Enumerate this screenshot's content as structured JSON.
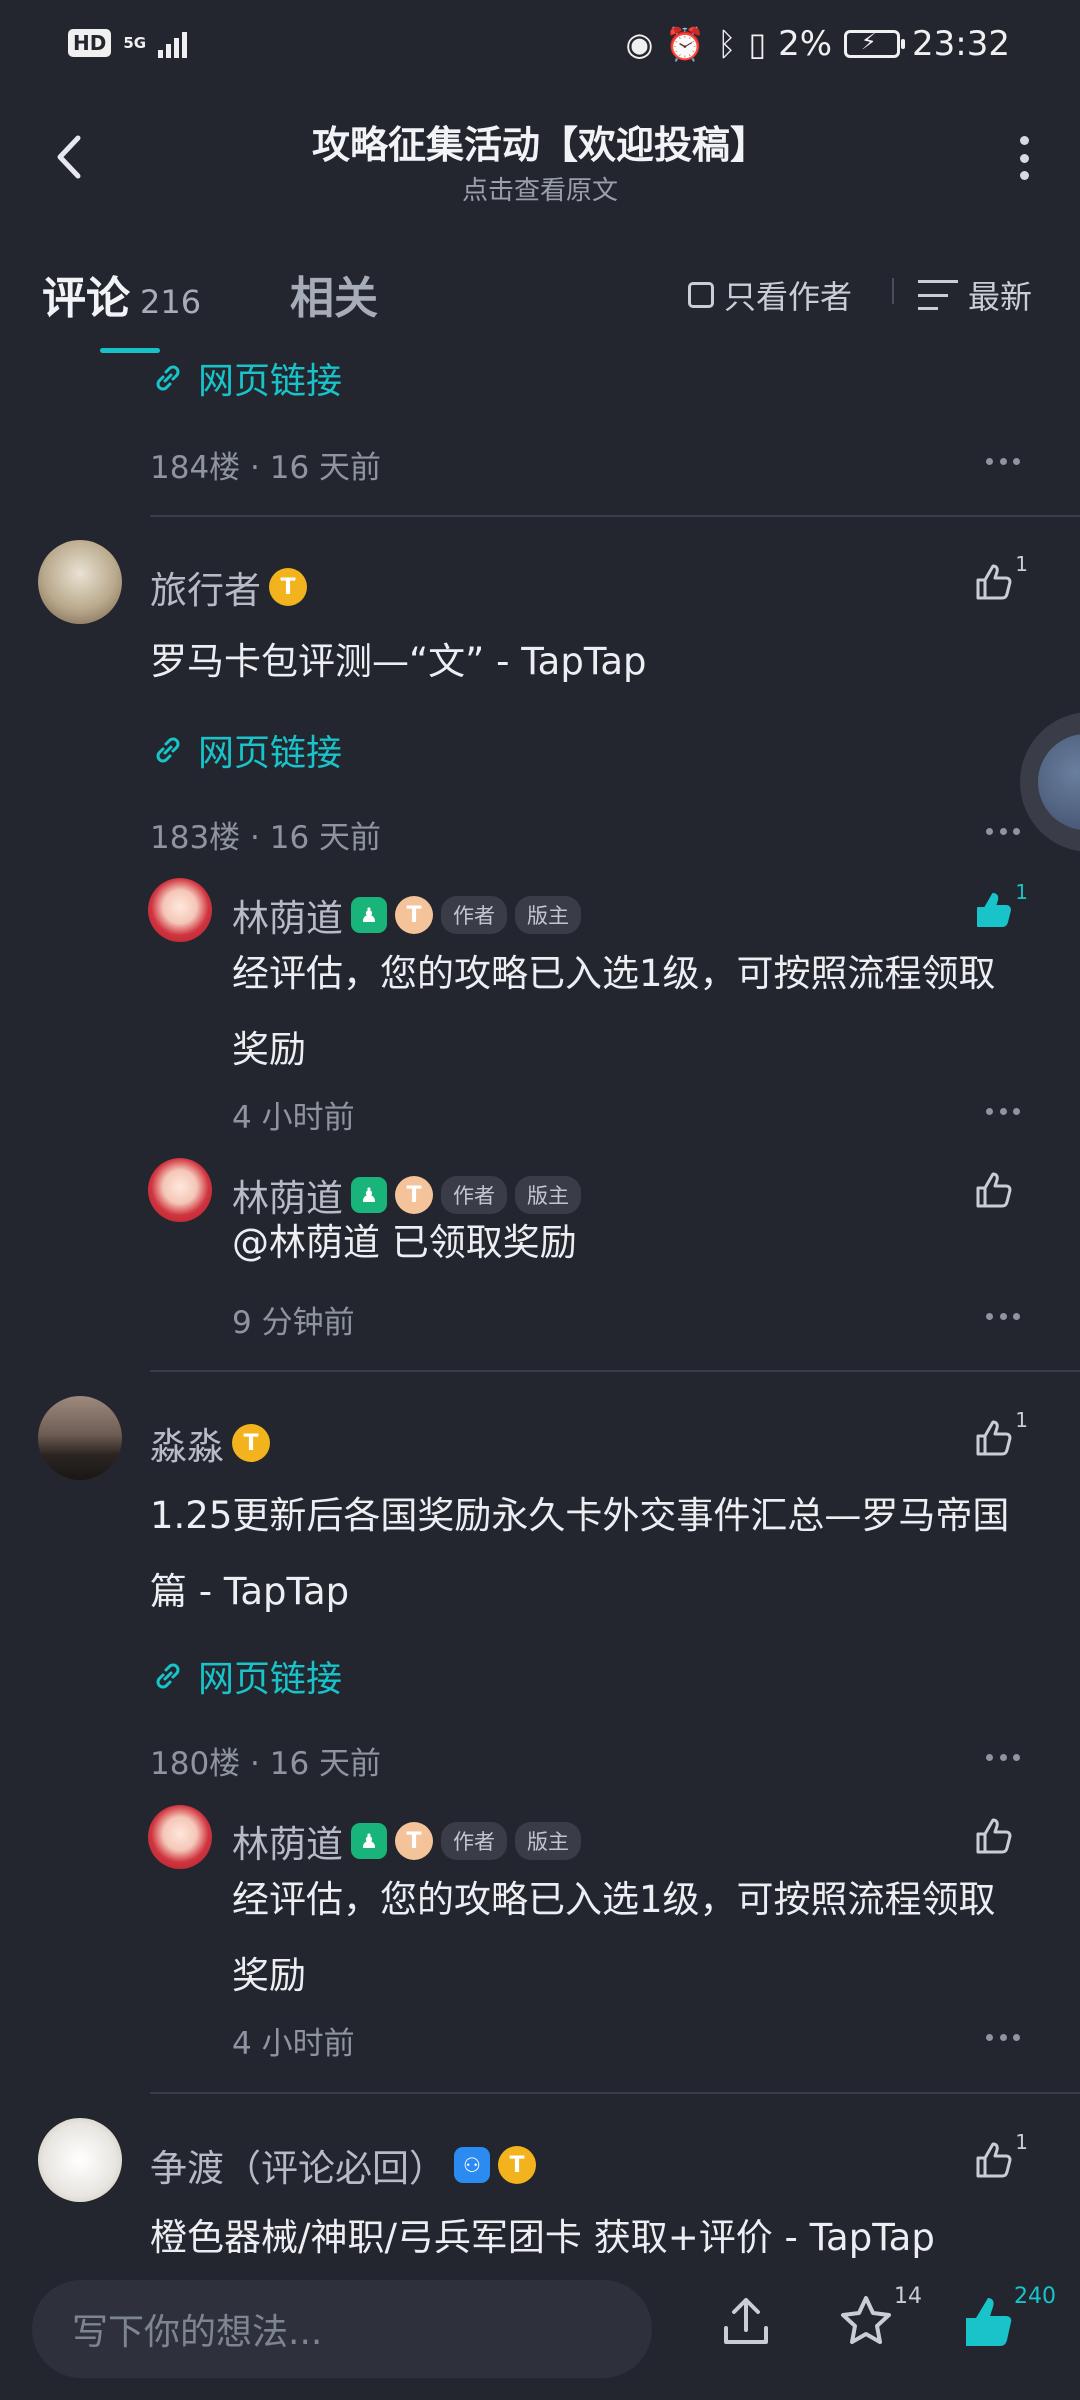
{
  "status_bar": {
    "hd": "HD",
    "network": "5G",
    "battery_percent": "2%",
    "time": "23:32"
  },
  "header": {
    "title": "攻略征集活动【欢迎投稿】",
    "subtitle": "点击查看原文"
  },
  "tabs": {
    "comments_label": "评论",
    "comments_count": "216",
    "related_label": "相关",
    "only_author": "只看作者",
    "sort": "最新"
  },
  "link_text": "网页链接",
  "posts": [
    {
      "floor_meta": "184楼 · 16 天前"
    },
    {
      "user": "旅行者",
      "text": "罗马卡包评测—“文” - TapTap",
      "like_count": "1",
      "floor_meta": "183楼 · 16 天前",
      "replies": [
        {
          "user": "林荫道",
          "tag_author": "作者",
          "tag_mod": "版主",
          "text": "经评估，您的攻略已入选1级，可按照流程领取奖励",
          "time": "4 小时前",
          "like_count": "1"
        },
        {
          "user": "林荫道",
          "tag_author": "作者",
          "tag_mod": "版主",
          "text": "@林荫道  已领取奖励",
          "time": "9 分钟前",
          "like_count": ""
        }
      ]
    },
    {
      "user": "淼淼",
      "text": "1.25更新后各国奖励永久卡外交事件汇总—罗马帝国篇 - TapTap",
      "like_count": "1",
      "floor_meta": "180楼 · 16 天前",
      "replies": [
        {
          "user": "林荫道",
          "tag_author": "作者",
          "tag_mod": "版主",
          "text": "经评估，您的攻略已入选1级，可按照流程领取奖励",
          "time": "4 小时前",
          "like_count": ""
        }
      ]
    },
    {
      "user": "争渡（评论必回）",
      "text": "橙色器械/神职/弓兵军团卡 获取+评价 - TapTap",
      "like_count": "1"
    }
  ],
  "bottom": {
    "compose_placeholder": "写下你的想法...",
    "star_count": "14",
    "like_count": "240"
  },
  "colors": {
    "accent": "#18c3c9",
    "background": "#23262f"
  }
}
